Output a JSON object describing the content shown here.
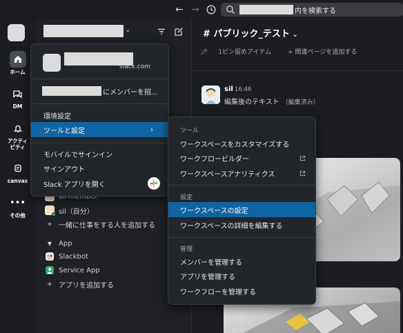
{
  "search": {
    "suffix": "内を検索する"
  },
  "rail": {
    "items": [
      {
        "label": "ホーム",
        "icon": "home-icon"
      },
      {
        "label": "DM",
        "icon": "dm-icon"
      },
      {
        "label": "アクティビティ",
        "icon": "bell-icon"
      },
      {
        "label": "canvas",
        "icon": "canvas-icon"
      },
      {
        "label": "その他",
        "icon": "more-icon"
      }
    ]
  },
  "sidebar": {
    "partial_member": "sil-member",
    "self_member": "sil（自分）",
    "add_people": "一緒に仕事をする人を追加する",
    "app_section": "App",
    "apps": [
      "Slackbot",
      "Service App"
    ],
    "add_app": "アプリを追加する"
  },
  "channel": {
    "title": "# パブリック_テスト",
    "pinned": "1ピン留めアイテム",
    "add_related": "関連ページを追加する",
    "message": {
      "author": "sil",
      "time": "16:46",
      "text": "編集後のテキスト",
      "edited": "（編集済み）"
    }
  },
  "workspace_menu": {
    "domain": "slack.com",
    "invite_suffix": "にメンバーを招...",
    "items": [
      "環境設定",
      "ツールと設定"
    ],
    "items2": [
      "モバイルでサインイン",
      "サインアウト",
      "Slack アプリを開く"
    ]
  },
  "tools_menu": {
    "header_tools": "ツール",
    "tools": [
      "ワークスペースをカスタマイズする",
      "ワークフロービルダー",
      "ワークスペースアナリティクス"
    ],
    "header_settings": "設定",
    "settings": [
      "ワークスペースの設定",
      "ワークスペースの詳細を編集する"
    ],
    "header_admin": "管理",
    "admin": [
      "メンバーを管理する",
      "アプリを管理する",
      "ワークフローを管理する"
    ]
  },
  "colors": {
    "selected": "#1164a3",
    "menu_bg": "#222529",
    "app_bg": "#1b1d21"
  }
}
